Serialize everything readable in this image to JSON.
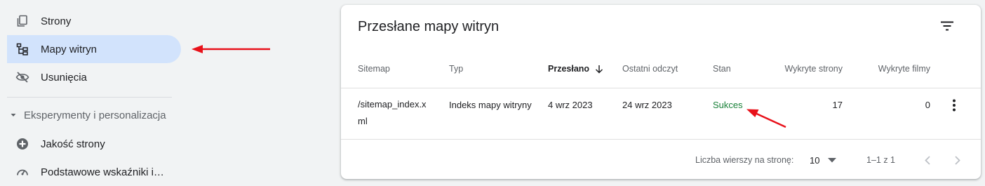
{
  "sidebar": {
    "items": [
      {
        "label": "Strony",
        "icon": "pages-icon"
      },
      {
        "label": "Mapy witryn",
        "icon": "sitemap-icon",
        "active": true
      },
      {
        "label": "Usunięcia",
        "icon": "removals-icon"
      }
    ],
    "section": {
      "label": "Eksperymenty i personalizacja",
      "icon": "caret-down-icon"
    },
    "section_items": [
      {
        "label": "Jakość strony",
        "icon": "page-quality-icon"
      },
      {
        "label": "Podstawowe wskaźniki i…",
        "icon": "web-vitals-icon"
      }
    ]
  },
  "card": {
    "title": "Przesłane mapy witryn",
    "filter_icon": "filter-icon",
    "columns": [
      {
        "key": "sitemap",
        "label": "Sitemap"
      },
      {
        "key": "type",
        "label": "Typ"
      },
      {
        "key": "submitted",
        "label": "Przesłano",
        "sorted": "desc"
      },
      {
        "key": "last_read",
        "label": "Ostatni odczyt"
      },
      {
        "key": "status",
        "label": "Stan"
      },
      {
        "key": "pages",
        "label": "Wykryte strony"
      },
      {
        "key": "videos",
        "label": "Wykryte filmy"
      }
    ],
    "rows": [
      {
        "sitemap_line1": "/sitemap_index.x",
        "sitemap_line2": "ml",
        "type": "Indeks mapy witryny",
        "submitted": "4 wrz 2023",
        "last_read": "24 wrz 2023",
        "status": "Sukces",
        "pages": "17",
        "videos": "0"
      }
    ],
    "footer": {
      "rows_per_page_label": "Liczba wierszy na stronę:",
      "rows_per_page_value": "10",
      "range": "1–1 z 1"
    }
  },
  "colors": {
    "accent_active_bg": "#d2e3fc",
    "status_success": "#188038",
    "annotation_arrow": "#e8111a"
  }
}
